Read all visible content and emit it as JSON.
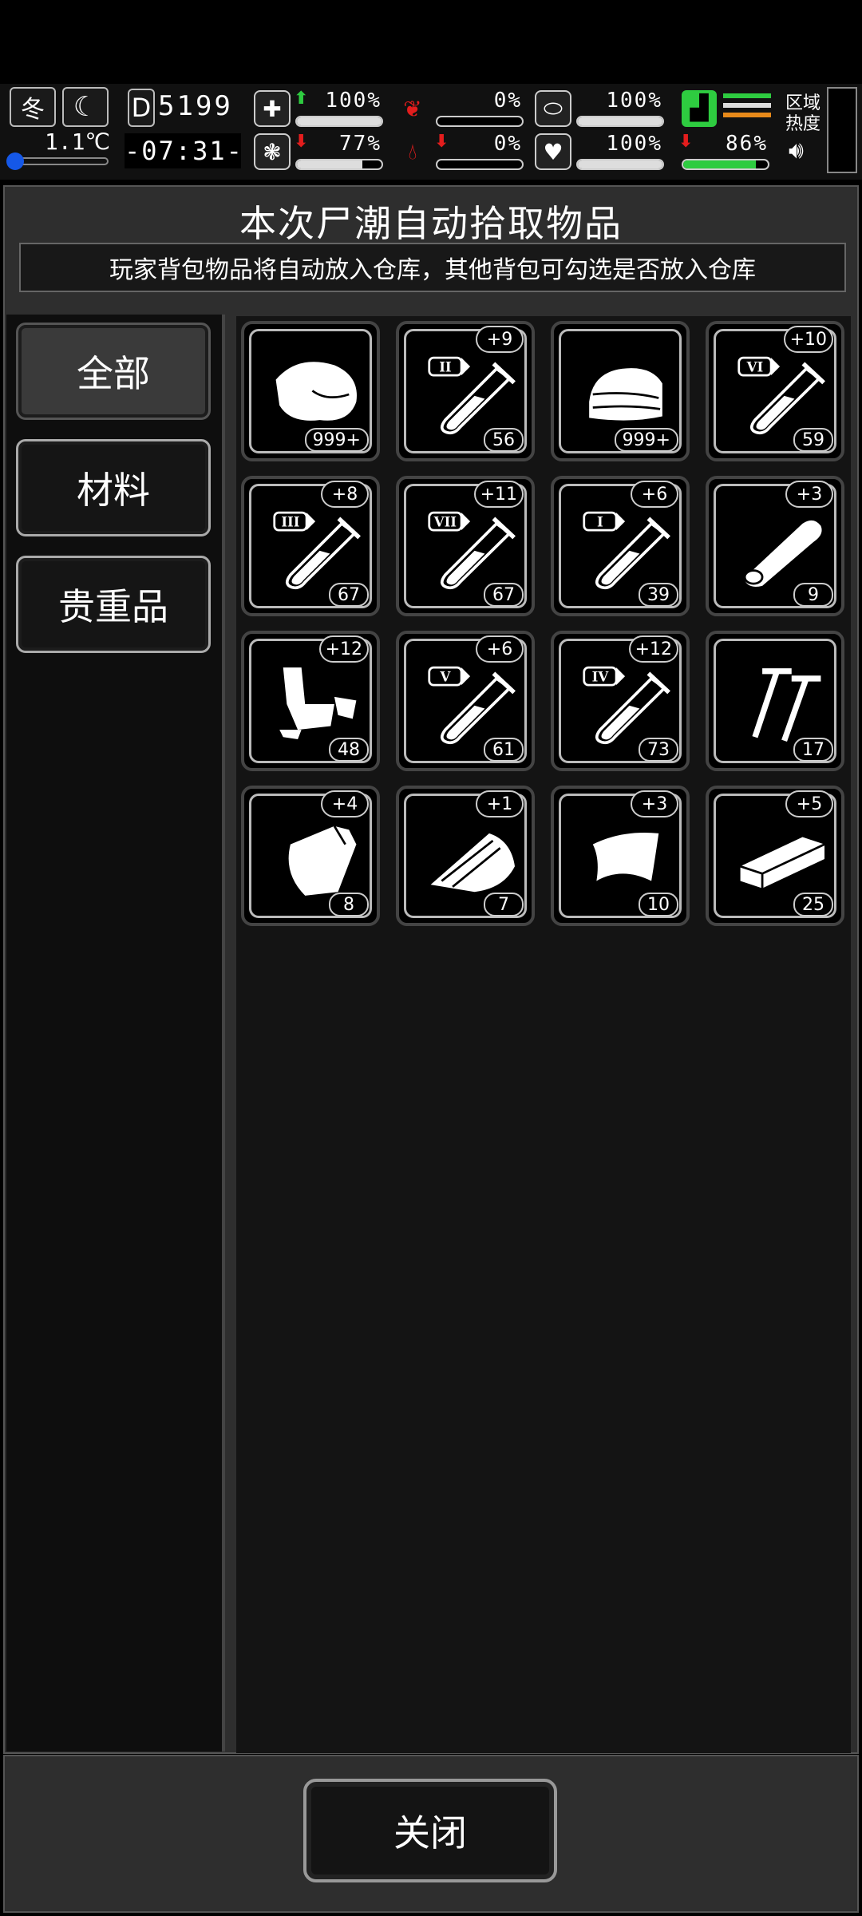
{
  "status_bar": {
    "season": "冬",
    "temperature": "1.1℃",
    "day_letter": "D",
    "day_number": "5199",
    "time": "-07:31-",
    "stats": [
      {
        "icon": "medkit-icon",
        "arrow": "up",
        "value": "100%",
        "fill": 1.0
      },
      {
        "icon": "stomach-icon",
        "arrow": "",
        "value": "0%",
        "fill": 0.0
      },
      {
        "icon": "capsule-icon",
        "arrow": "",
        "value": "100%",
        "fill": 1.0
      },
      {
        "icon": "brain-icon",
        "arrow": "down",
        "value": "77%",
        "fill": 0.77
      },
      {
        "icon": "blood-drop-icon",
        "arrow": "down",
        "value": "0%",
        "fill": 0.0
      },
      {
        "icon": "heart-icon",
        "arrow": "",
        "value": "100%",
        "fill": 1.0
      },
      {
        "icon": "boot-icon",
        "arrow": "down",
        "value": "86%",
        "fill": 0.86
      }
    ],
    "zone_heat_label": "区域热度"
  },
  "dialog": {
    "title": "本次尸潮自动拾取物品",
    "subtitle": "玩家背包物品将自动放入仓库，其他背包可勾选是否放入仓库",
    "tabs": [
      {
        "label": "全部",
        "active": true
      },
      {
        "label": "材料",
        "active": false
      },
      {
        "label": "贵重品",
        "active": false
      }
    ],
    "items": [
      {
        "icon": "meat-icon",
        "count": "999+",
        "bonus": ""
      },
      {
        "icon": "test-tube-icon",
        "roman": "II",
        "count": "56",
        "bonus": "+9"
      },
      {
        "icon": "cloth-icon",
        "count": "999+",
        "bonus": ""
      },
      {
        "icon": "test-tube-icon",
        "roman": "VI",
        "count": "59",
        "bonus": "+10"
      },
      {
        "icon": "test-tube-icon",
        "roman": "III",
        "count": "67",
        "bonus": "+8"
      },
      {
        "icon": "test-tube-icon",
        "roman": "VII",
        "count": "67",
        "bonus": "+11"
      },
      {
        "icon": "test-tube-icon",
        "roman": "I",
        "count": "39",
        "bonus": "+6"
      },
      {
        "icon": "wood-log-icon",
        "count": "9",
        "bonus": "+3"
      },
      {
        "icon": "scrap-metal-icon",
        "count": "48",
        "bonus": "+12"
      },
      {
        "icon": "test-tube-icon",
        "roman": "V",
        "count": "61",
        "bonus": "+6"
      },
      {
        "icon": "test-tube-icon",
        "roman": "IV",
        "count": "73",
        "bonus": "+12"
      },
      {
        "icon": "nails-icon",
        "count": "17",
        "bonus": ""
      },
      {
        "icon": "bag-icon",
        "count": "8",
        "bonus": "+4"
      },
      {
        "icon": "wood-planks-icon",
        "count": "7",
        "bonus": "+1"
      },
      {
        "icon": "leather-icon",
        "count": "10",
        "bonus": "+3"
      },
      {
        "icon": "board-icon",
        "count": "25",
        "bonus": "+5"
      }
    ],
    "close_label": "关闭"
  },
  "colors": {
    "accent_green": "#2ecc40",
    "accent_red": "#e31d1d",
    "panel": "#2e2e2e"
  }
}
